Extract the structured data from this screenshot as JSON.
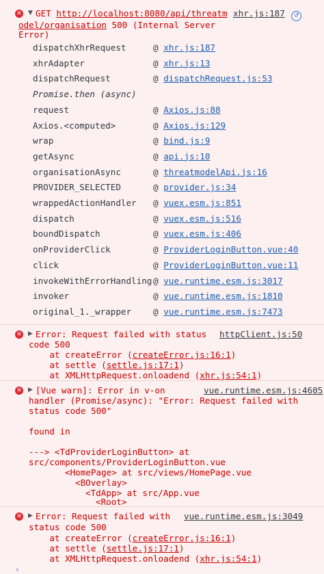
{
  "msg1": {
    "prefix": "GET ",
    "url_line1": "http://localhost:8080/api/threatm",
    "url_line2": "odel/organisation",
    "status_line2": " 500 (Internal Server",
    "line3": "Error)",
    "source": "xhr.js:187",
    "stack": [
      {
        "fn": "dispatchXhrRequest",
        "loc": "xhr.js:187"
      },
      {
        "fn": "xhrAdapter",
        "loc": "xhr.js:13"
      },
      {
        "fn": "dispatchRequest",
        "loc": "dispatchRequest.js:53"
      },
      {
        "fn": "request",
        "loc": "Axios.js:88"
      },
      {
        "fn": "Axios.<computed>",
        "loc": "Axios.js:129"
      },
      {
        "fn": "wrap",
        "loc": "bind.js:9"
      },
      {
        "fn": "getAsync",
        "loc": "api.js:10"
      },
      {
        "fn": "organisationAsync",
        "loc": "threatmodelApi.js:16"
      },
      {
        "fn": "PROVIDER_SELECTED",
        "loc": "provider.js:34"
      },
      {
        "fn": "wrappedActionHandler",
        "loc": "vuex.esm.js:851"
      },
      {
        "fn": "dispatch",
        "loc": "vuex.esm.js:516"
      },
      {
        "fn": "boundDispatch",
        "loc": "vuex.esm.js:406"
      },
      {
        "fn": "onProviderClick",
        "loc": "ProviderLoginButton.vue:40"
      },
      {
        "fn": "click",
        "loc": "ProviderLoginButton.vue:11"
      },
      {
        "fn": "invokeWithErrorHandling",
        "loc": "vue.runtime.esm.js:3017"
      },
      {
        "fn": "invoker",
        "loc": "vue.runtime.esm.js:1810"
      },
      {
        "fn": "original_1._wrapper",
        "loc": "vue.runtime.esm.js:7473"
      }
    ],
    "async_label": "Promise.then (async)",
    "at_sign": "@"
  },
  "msg2": {
    "line1": "Error: Request failed with status",
    "source": "httpClient.js:50",
    "line2": "code 500",
    "at1_pre": "    at createError (",
    "at1_link": "createError.js:16:1",
    "at2_pre": "    at settle (",
    "at2_link": "settle.js:17:1",
    "at3_pre": "    at XMLHttpRequest.onloadend (",
    "at3_link": "xhr.js:54:1",
    "close": ")"
  },
  "msg3": {
    "line1": "[Vue warn]: Error in v-on",
    "source": "vue.runtime.esm.js:4605",
    "line2": "handler (Promise/async): \"Error: Request failed with",
    "line3": "status code 500\"",
    "found": "found in",
    "tree1": "---> <TdProviderLoginButton> at",
    "tree2": "src/components/ProviderLoginButton.vue",
    "tree3": "<HomePage> at src/views/HomePage.vue",
    "tree4": "<BOverlay>",
    "tree5": "<TdApp> at src/App.vue",
    "tree6": "<Root>"
  },
  "msg4": {
    "line1": "Error: Request failed with",
    "source": "vue.runtime.esm.js:3049",
    "line2": "status code 500",
    "at1_pre": "    at createError (",
    "at1_link": "createError.js:16:1",
    "at2_pre": "    at settle (",
    "at2_link": "settle.js:17:1",
    "at3_pre": "    at XMLHttpRequest.onloadend (",
    "at3_link": "xhr.js:54:1",
    "close": ")"
  },
  "icons": {
    "error": "error-icon",
    "expand": "triangle-right-icon",
    "expanded": "triangle-down-icon",
    "network": "network-request-icon",
    "prompt": "chevron-right-icon"
  }
}
